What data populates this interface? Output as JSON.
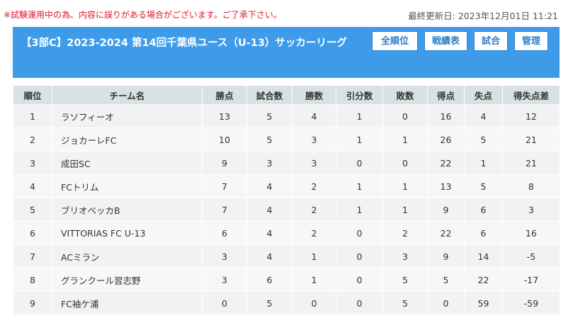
{
  "notice": "※試験運用中の為、内容に誤りがある場合がございます。ご了承下さい。",
  "last_updated": "最終更新日: 2023年12月01日 11:21",
  "banner": {
    "title": "【3部C】2023-2024 第14回千葉県ユース（U-13）サッカーリーグ",
    "buttons": [
      "全順位",
      "戦績表",
      "試合",
      "管理"
    ]
  },
  "colors": {
    "banner": "#3e9bea",
    "notice": "#e0162b",
    "header_bg": "#d8e1e4"
  },
  "table": {
    "headers": [
      "順位",
      "チーム名",
      "勝点",
      "試合数",
      "勝数",
      "引分数",
      "敗数",
      "得点",
      "失点",
      "得失点差"
    ],
    "rows": [
      [
        "1",
        "ラソフィーオ",
        "13",
        "5",
        "4",
        "1",
        "0",
        "16",
        "4",
        "12"
      ],
      [
        "2",
        "ジョカーレFC",
        "10",
        "5",
        "3",
        "1",
        "1",
        "26",
        "5",
        "21"
      ],
      [
        "3",
        "成田SC",
        "9",
        "3",
        "3",
        "0",
        "0",
        "22",
        "1",
        "21"
      ],
      [
        "4",
        "FCトリム",
        "7",
        "4",
        "2",
        "1",
        "1",
        "13",
        "5",
        "8"
      ],
      [
        "5",
        "ブリオベッカB",
        "7",
        "4",
        "2",
        "1",
        "1",
        "9",
        "6",
        "3"
      ],
      [
        "6",
        "VITTORIAS FC U-13",
        "6",
        "4",
        "2",
        "0",
        "2",
        "22",
        "6",
        "16"
      ],
      [
        "7",
        "ACミラン",
        "3",
        "4",
        "1",
        "0",
        "3",
        "9",
        "14",
        "-5"
      ],
      [
        "8",
        "グランクール習志野",
        "3",
        "6",
        "1",
        "0",
        "5",
        "5",
        "22",
        "-17"
      ],
      [
        "9",
        "FC袖ケ浦",
        "0",
        "5",
        "0",
        "0",
        "5",
        "0",
        "59",
        "-59"
      ]
    ]
  }
}
